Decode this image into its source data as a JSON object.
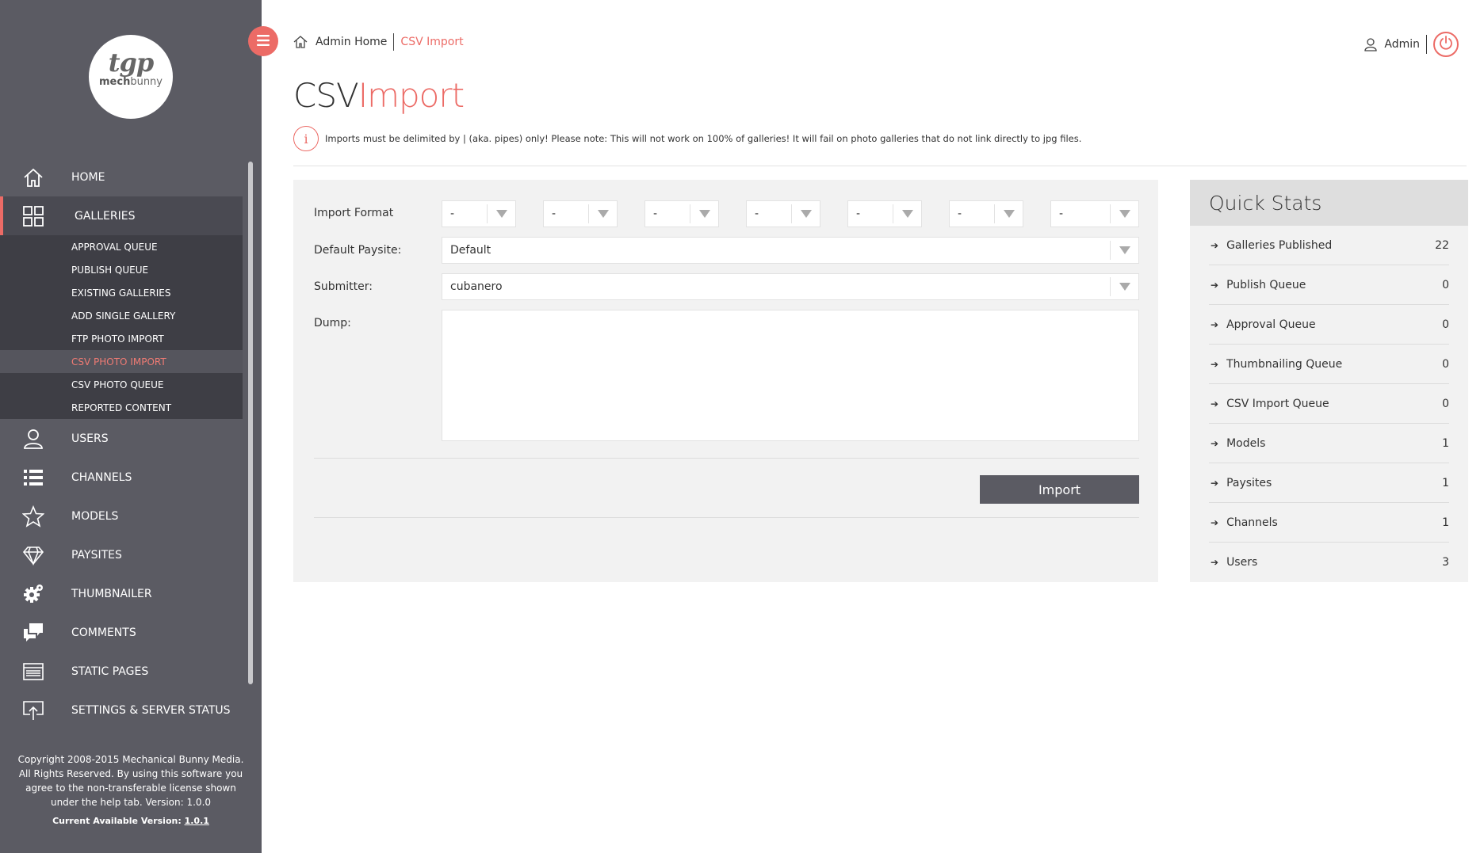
{
  "logo": {
    "brand": "tgp",
    "sub_a": "mech",
    "sub_b": "bunny"
  },
  "nav": {
    "items": [
      {
        "label": "HOME"
      },
      {
        "label": "GALLERIES"
      },
      {
        "label": "USERS"
      },
      {
        "label": "CHANNELS"
      },
      {
        "label": "MODELS"
      },
      {
        "label": "PAYSITES"
      },
      {
        "label": "THUMBNAILER"
      },
      {
        "label": "COMMENTS"
      },
      {
        "label": "STATIC PAGES"
      },
      {
        "label": "SETTINGS & SERVER STATUS"
      }
    ],
    "sub": [
      {
        "label": "APPROVAL QUEUE"
      },
      {
        "label": "PUBLISH QUEUE"
      },
      {
        "label": "EXISTING GALLERIES"
      },
      {
        "label": "ADD SINGLE GALLERY"
      },
      {
        "label": "FTP PHOTO IMPORT"
      },
      {
        "label": "CSV PHOTO IMPORT"
      },
      {
        "label": "CSV PHOTO QUEUE"
      },
      {
        "label": "REPORTED CONTENT"
      }
    ]
  },
  "footer": {
    "line1": "Copyright 2008-2015 Mechanical Bunny Media.",
    "line2": "All Rights Reserved. By using this software you",
    "line3": "agree to the non-transferable license shown",
    "line4": "under the help tab. Version: 1.0.0",
    "version_label": "Current Available Version:",
    "version": "1.0.1"
  },
  "breadcrumb": {
    "home": "Admin Home",
    "current": "CSV Import"
  },
  "user": {
    "name": "Admin"
  },
  "title": {
    "part1": "CSV",
    "part2": "Import"
  },
  "notice": {
    "icon": "i",
    "text": "Imports must be delimited by | (aka. pipes) only! Please note: This will not work on 100% of galleries! It will fail on photo galleries that do not link directly to jpg files."
  },
  "form": {
    "import_format_label": "Import Format",
    "format_values": [
      "-",
      "-",
      "-",
      "-",
      "-",
      "-",
      "-"
    ],
    "paysite_label": "Default Paysite:",
    "paysite_value": "Default",
    "submitter_label": "Submitter:",
    "submitter_value": "cubanero",
    "dump_label": "Dump:",
    "dump_value": "",
    "import_button": "Import"
  },
  "stats": {
    "title": "Quick Stats",
    "rows": [
      {
        "label": "Galleries Published",
        "value": "22"
      },
      {
        "label": "Publish Queue",
        "value": "0"
      },
      {
        "label": "Approval Queue",
        "value": "0"
      },
      {
        "label": "Thumbnailing Queue",
        "value": "0"
      },
      {
        "label": "CSV Import Queue",
        "value": "0"
      },
      {
        "label": "Models",
        "value": "1"
      },
      {
        "label": "Paysites",
        "value": "1"
      },
      {
        "label": "Channels",
        "value": "1"
      },
      {
        "label": "Users",
        "value": "3"
      }
    ]
  },
  "colors": {
    "accent": "#ec6b66",
    "sidebar": "#5b5b63",
    "submenu": "#3e3e45",
    "panel": "#f2f2f2"
  }
}
